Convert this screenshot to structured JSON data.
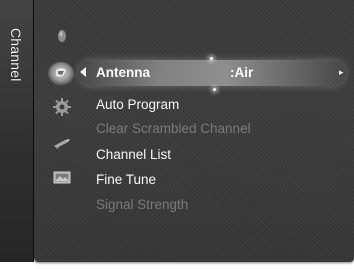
{
  "side_tab": {
    "label": "Channel",
    "icon": "channel-tab"
  },
  "icons": [
    {
      "name": "picture-icon",
      "active": false
    },
    {
      "name": "sound-icon",
      "active": false
    },
    {
      "name": "channel-icon",
      "active": true
    },
    {
      "name": "setup-icon",
      "active": false
    },
    {
      "name": "input-icon",
      "active": false
    },
    {
      "name": "application-icon",
      "active": false
    }
  ],
  "menu": {
    "items": [
      {
        "label": "Antenna",
        "value": ":Air",
        "state": "active"
      },
      {
        "label": "Auto Program",
        "state": "enabled"
      },
      {
        "label": "Clear Scrambled Channel",
        "state": "disabled"
      },
      {
        "label": "Channel List",
        "state": "enabled"
      },
      {
        "label": "Fine Tune",
        "state": "enabled"
      },
      {
        "label": "Signal Strength",
        "state": "disabled"
      }
    ]
  },
  "colors": {
    "panel": "#3a3a3a",
    "text_enabled": "#f7f7f7",
    "text_disabled": "#7a7a7a",
    "highlight": "#ffffff"
  }
}
